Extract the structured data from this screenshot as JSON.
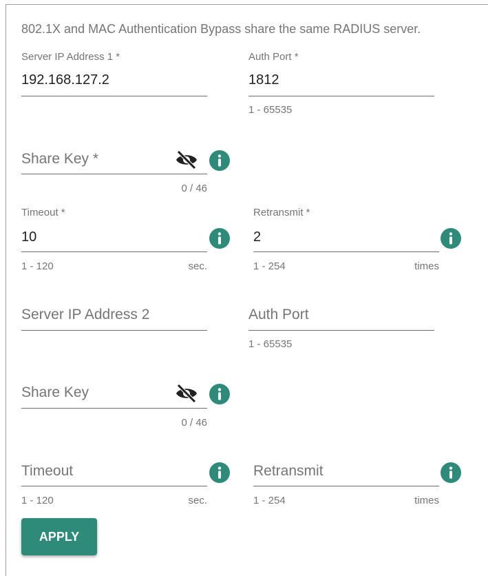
{
  "notice": "802.1X and MAC Authentication Bypass share the same RADIUS server.",
  "server1": {
    "ip_label": "Server IP Address 1 *",
    "ip_value": "192.168.127.2",
    "port_label": "Auth Port *",
    "port_value": "1812",
    "port_hint": "1 - 65535",
    "sharekey_placeholder": "Share Key *",
    "sharekey_counter": "0 / 46",
    "timeout_label": "Timeout *",
    "timeout_value": "10",
    "timeout_hint": "1 - 120",
    "timeout_unit": "sec.",
    "retransmit_label": "Retransmit *",
    "retransmit_value": "2",
    "retransmit_hint": "1 - 254",
    "retransmit_unit": "times"
  },
  "server2": {
    "ip_placeholder": "Server IP Address 2",
    "port_placeholder": "Auth Port",
    "port_hint": "1 - 65535",
    "sharekey_placeholder": "Share Key",
    "sharekey_counter": "0 / 46",
    "timeout_placeholder": "Timeout",
    "timeout_hint": "1 - 120",
    "timeout_unit": "sec.",
    "retransmit_placeholder": "Retransmit",
    "retransmit_hint": "1 - 254",
    "retransmit_unit": "times"
  },
  "apply_label": "APPLY",
  "icons": {
    "info": "info-icon",
    "visibility": "visibility-off-icon"
  },
  "colors": {
    "accent": "#2e8b7a",
    "text": "#212121",
    "muted": "#757575"
  }
}
